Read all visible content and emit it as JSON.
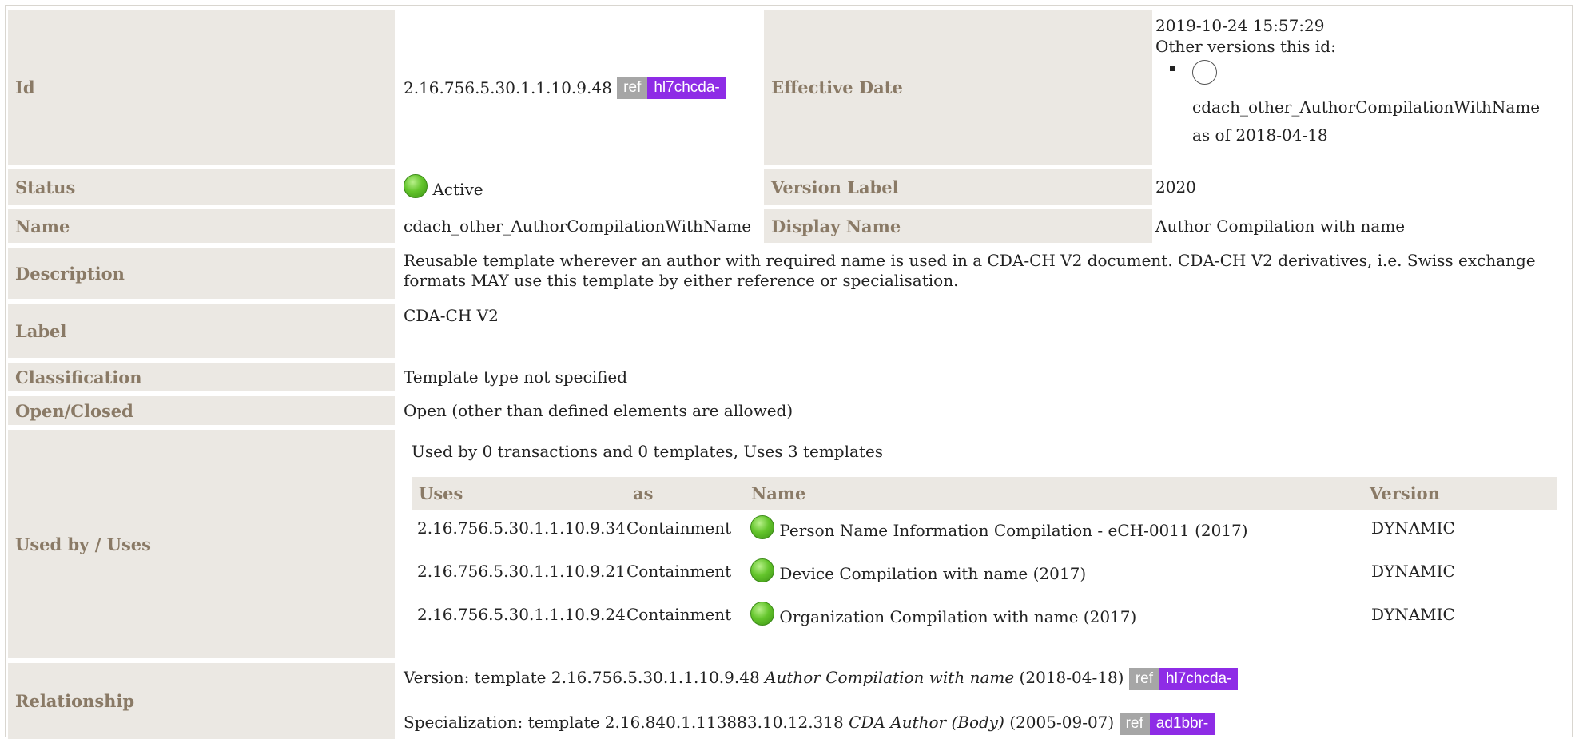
{
  "id_row": {
    "label": "Id",
    "value": "2.16.756.5.30.1.1.10.9.48",
    "ref_badge": "ref",
    "prefix_badge": "hl7chcda-",
    "label2": "Effective Date",
    "effective_date": "2019-10-24 15:57:29",
    "other_versions_label": "Other versions this id:",
    "other_version_name": "cdach_other_AuthorCompilationWithName",
    "other_version_date": "as of 2018-04-18"
  },
  "status_row": {
    "label": "Status",
    "value": "Active",
    "label2": "Version Label",
    "value2": "2020"
  },
  "name_row": {
    "label": "Name",
    "value": "cdach_other_AuthorCompilationWithName",
    "label2": "Display Name",
    "value2": "Author Compilation with name"
  },
  "description_row": {
    "label": "Description",
    "value": "Reusable template wherever an author with required name is used in a CDA-CH V2 document. CDA-CH V2 derivatives, i.e. Swiss exchange formats MAY use this template by either reference or specialisation."
  },
  "label_row": {
    "label": "Label",
    "value": "CDA-CH V2"
  },
  "classification_row": {
    "label": "Classification",
    "value": "Template type not specified"
  },
  "open_closed_row": {
    "label": "Open/Closed",
    "value": "Open (other than defined elements are allowed)"
  },
  "used_by_row": {
    "label": "Used by / Uses",
    "summary": "Used by 0 transactions and 0 templates, Uses 3 templates",
    "columns": [
      "Uses",
      "as",
      "Name",
      "Version"
    ],
    "rows": [
      {
        "uses": "2.16.756.5.30.1.1.10.9.34",
        "as": "Containment",
        "name": "Person Name Information Compilation - eCH-0011 (2017)",
        "version": "DYNAMIC"
      },
      {
        "uses": "2.16.756.5.30.1.1.10.9.21",
        "as": "Containment",
        "name": "Device Compilation with name (2017)",
        "version": "DYNAMIC"
      },
      {
        "uses": "2.16.756.5.30.1.1.10.9.24",
        "as": "Containment",
        "name": "Organization Compilation with name (2017)",
        "version": "DYNAMIC"
      }
    ]
  },
  "relationship_row": {
    "label": "Relationship",
    "version_prefix": "Version: template 2.16.756.5.30.1.1.10.9.48",
    "version_name": "Author Compilation with name",
    "version_date": "(2018-04-18)",
    "version_ref": "ref",
    "version_badge": "hl7chcda-",
    "spec_prefix": "Specialization: template 2.16.840.1.113883.10.12.318",
    "spec_name": "CDA Author (Body)",
    "spec_date": "(2005-09-07)",
    "spec_ref": "ref",
    "spec_badge": "ad1bbr-"
  },
  "colors": {
    "label_bg": "#ebe8e3",
    "label_text": "#8a7a66",
    "ref_badge": "#a6a6a6",
    "prefix_badge": "#8e2ce6",
    "status_active": "#64c52c"
  }
}
